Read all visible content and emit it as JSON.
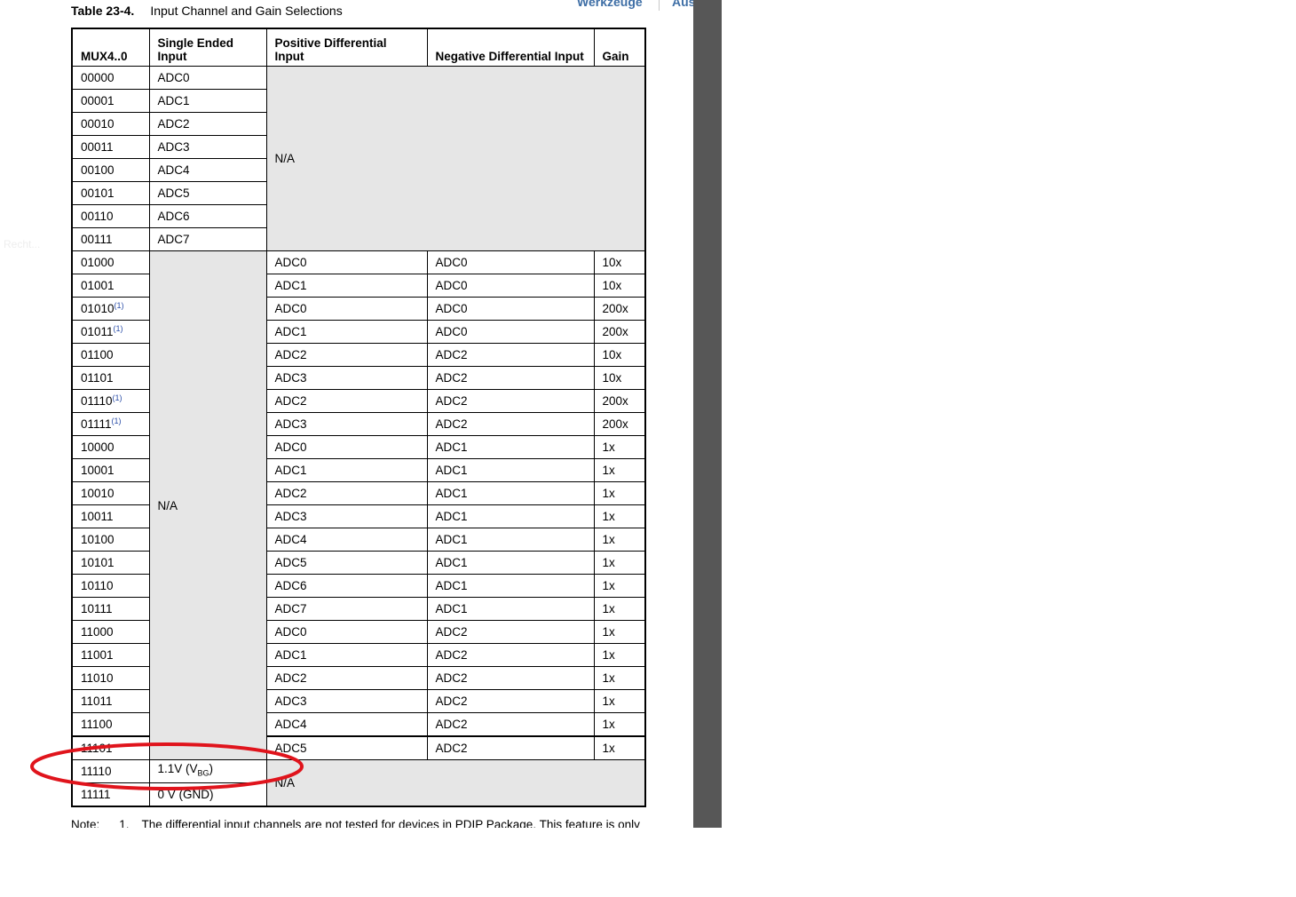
{
  "toolbar": {
    "tools_label": "Werkzeuge",
    "fill_label": "Ausfülle"
  },
  "background_text": "Recht...",
  "table": {
    "caption_number": "Table 23-4.",
    "caption_title": "Input Channel and Gain Selections",
    "headers": {
      "mux": "MUX4..0",
      "single_ended": "Single Ended Input",
      "positive": "Positive Differential Input",
      "negative": "Negative Differential Input",
      "gain": "Gain"
    },
    "single_ended_rows": [
      {
        "mux": "00000",
        "input": "ADC0"
      },
      {
        "mux": "00001",
        "input": "ADC1"
      },
      {
        "mux": "00010",
        "input": "ADC2"
      },
      {
        "mux": "00011",
        "input": "ADC3"
      },
      {
        "mux": "00100",
        "input": "ADC4"
      },
      {
        "mux": "00101",
        "input": "ADC5"
      },
      {
        "mux": "00110",
        "input": "ADC6"
      },
      {
        "mux": "00111",
        "input": "ADC7"
      }
    ],
    "single_ended_diff_na": "N/A",
    "differential_rows": [
      {
        "mux": "01000",
        "fn": "",
        "pos": "ADC0",
        "neg": "ADC0",
        "gain": "10x"
      },
      {
        "mux": "01001",
        "fn": "",
        "pos": "ADC1",
        "neg": "ADC0",
        "gain": "10x"
      },
      {
        "mux": "01010",
        "fn": "(1)",
        "pos": "ADC0",
        "neg": "ADC0",
        "gain": "200x"
      },
      {
        "mux": "01011",
        "fn": "(1)",
        "pos": "ADC1",
        "neg": "ADC0",
        "gain": "200x"
      },
      {
        "mux": "01100",
        "fn": "",
        "pos": "ADC2",
        "neg": "ADC2",
        "gain": "10x"
      },
      {
        "mux": "01101",
        "fn": "",
        "pos": "ADC3",
        "neg": "ADC2",
        "gain": "10x"
      },
      {
        "mux": "01110",
        "fn": "(1)",
        "pos": "ADC2",
        "neg": "ADC2",
        "gain": "200x"
      },
      {
        "mux": "01111",
        "fn": "(1)",
        "pos": "ADC3",
        "neg": "ADC2",
        "gain": "200x"
      },
      {
        "mux": "10000",
        "fn": "",
        "pos": "ADC0",
        "neg": "ADC1",
        "gain": "1x"
      },
      {
        "mux": "10001",
        "fn": "",
        "pos": "ADC1",
        "neg": "ADC1",
        "gain": "1x"
      },
      {
        "mux": "10010",
        "fn": "",
        "pos": "ADC2",
        "neg": "ADC1",
        "gain": "1x"
      },
      {
        "mux": "10011",
        "fn": "",
        "pos": "ADC3",
        "neg": "ADC1",
        "gain": "1x"
      },
      {
        "mux": "10100",
        "fn": "",
        "pos": "ADC4",
        "neg": "ADC1",
        "gain": "1x"
      },
      {
        "mux": "10101",
        "fn": "",
        "pos": "ADC5",
        "neg": "ADC1",
        "gain": "1x"
      },
      {
        "mux": "10110",
        "fn": "",
        "pos": "ADC6",
        "neg": "ADC1",
        "gain": "1x"
      },
      {
        "mux": "10111",
        "fn": "",
        "pos": "ADC7",
        "neg": "ADC1",
        "gain": "1x"
      },
      {
        "mux": "11000",
        "fn": "",
        "pos": "ADC0",
        "neg": "ADC2",
        "gain": "1x"
      },
      {
        "mux": "11001",
        "fn": "",
        "pos": "ADC1",
        "neg": "ADC2",
        "gain": "1x"
      },
      {
        "mux": "11010",
        "fn": "",
        "pos": "ADC2",
        "neg": "ADC2",
        "gain": "1x"
      },
      {
        "mux": "11011",
        "fn": "",
        "pos": "ADC3",
        "neg": "ADC2",
        "gain": "1x"
      },
      {
        "mux": "11100",
        "fn": "",
        "pos": "ADC4",
        "neg": "ADC2",
        "gain": "1x"
      },
      {
        "mux": "11101",
        "fn": "",
        "pos": "ADC5",
        "neg": "ADC2",
        "gain": "1x"
      }
    ],
    "differential_single_na": "N/A",
    "special_rows": [
      {
        "mux": "11110",
        "input_main": "1.1V (V",
        "input_sub": "BG",
        "input_end": ")"
      },
      {
        "mux": "11111",
        "input_main": "0 V (GND)",
        "input_sub": "",
        "input_end": ""
      }
    ],
    "special_diff_na": "N/A"
  },
  "note": {
    "label": "Note:",
    "number": "1.",
    "text": "The differential input channels are not tested for devices in PDIP Package. This feature is only"
  },
  "annotation": {
    "color": "#e0141c"
  }
}
